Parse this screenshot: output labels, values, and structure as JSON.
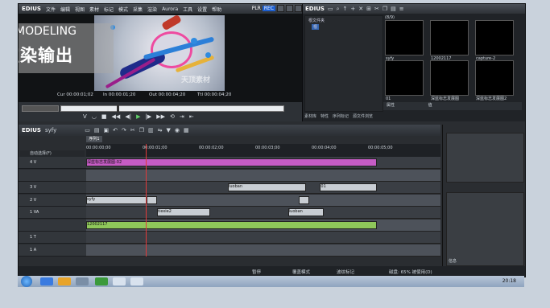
{
  "app": {
    "logo": "EDIUS",
    "menu": [
      "文件",
      "编辑",
      "视图",
      "素材",
      "标记",
      "模式",
      "采集",
      "渲染",
      "Aurora",
      "工具",
      "设置",
      "帮助"
    ],
    "plr": "PLR",
    "rec": "REC"
  },
  "overlay": {
    "en": "MODELING",
    "cn": "渲染输出"
  },
  "monitor": {
    "watermark": "天顶素材",
    "timecodes": [
      {
        "label": "Cur",
        "value": "00:00:01;02"
      },
      {
        "label": "In",
        "value": "00:00:01;20"
      },
      {
        "label": "Out",
        "value": "00:00:04;20"
      },
      {
        "label": "Ttl",
        "value": "00:00:04;20"
      }
    ],
    "scrub_progress": 0.25
  },
  "bin": {
    "title": "EDIUS",
    "tree_root": "根文件夹",
    "folder_label": "根",
    "clip_count": "(8/9)",
    "clips": [
      {
        "name": "syfy"
      },
      {
        "name": "12002117"
      },
      {
        "name": "capture-2"
      },
      {
        "name": "01"
      },
      {
        "name": "深蓝标志发展图"
      },
      {
        "name": "深蓝标志发展图2"
      }
    ],
    "props": [
      "属性",
      "值"
    ],
    "tabs": [
      "素材库",
      "特性",
      "序列标记",
      "源文件浏览"
    ]
  },
  "timeline": {
    "title": "EDIUS",
    "project": "syfy",
    "seq_tab": "序列1",
    "mode_label": "自动选择(F)",
    "ruler": [
      "00:00:00;00",
      "00:00:01;00",
      "00:00:02;00",
      "00:00:03;00",
      "00:00:04;00",
      "00:00:05;00"
    ],
    "tracks": [
      {
        "name": "4 V",
        "clips": [
          {
            "label": "深蓝标志发展图-02",
            "start": 0,
            "end": 0.82,
            "color": "#c65cc5"
          }
        ]
      },
      {
        "name": "",
        "clips": []
      },
      {
        "name": "3 V",
        "clips": [
          {
            "label": "luoban",
            "start": 0.4,
            "end": 0.62,
            "color": "#c8cdd3"
          },
          {
            "label": "01",
            "start": 0.66,
            "end": 0.82,
            "color": "#c8cdd3"
          }
        ]
      },
      {
        "name": "2 V",
        "clips": [
          {
            "label": "syfy",
            "start": 0,
            "end": 0.17,
            "color": "#c8cdd3"
          },
          {
            "label": "",
            "start": 0.17,
            "end": 0.2,
            "color": "#c8cdd3"
          },
          {
            "label": "",
            "start": 0.6,
            "end": 0.63,
            "color": "#c8cdd3"
          }
        ]
      },
      {
        "name": "1 VA",
        "clips": [
          {
            "label": "tiexie2",
            "start": 0.2,
            "end": 0.35,
            "color": "#c8cdd3"
          },
          {
            "label": "luoban",
            "start": 0.57,
            "end": 0.67,
            "color": "#c8cdd3"
          }
        ]
      },
      {
        "name": "",
        "clips": [
          {
            "label": "12002117",
            "start": 0,
            "end": 0.82,
            "color": "#8fc85a"
          }
        ]
      },
      {
        "name": "1 T",
        "clips": []
      },
      {
        "name": "1 A",
        "clips": []
      }
    ]
  },
  "status": {
    "stop": "暂停",
    "overwrite": "覆盖模式",
    "ripple": "波纹标记",
    "disk": "磁盘: 65% 被使用(D)"
  },
  "right_panel": {
    "info": "信息"
  },
  "taskbar": {
    "clock": "20:18"
  }
}
